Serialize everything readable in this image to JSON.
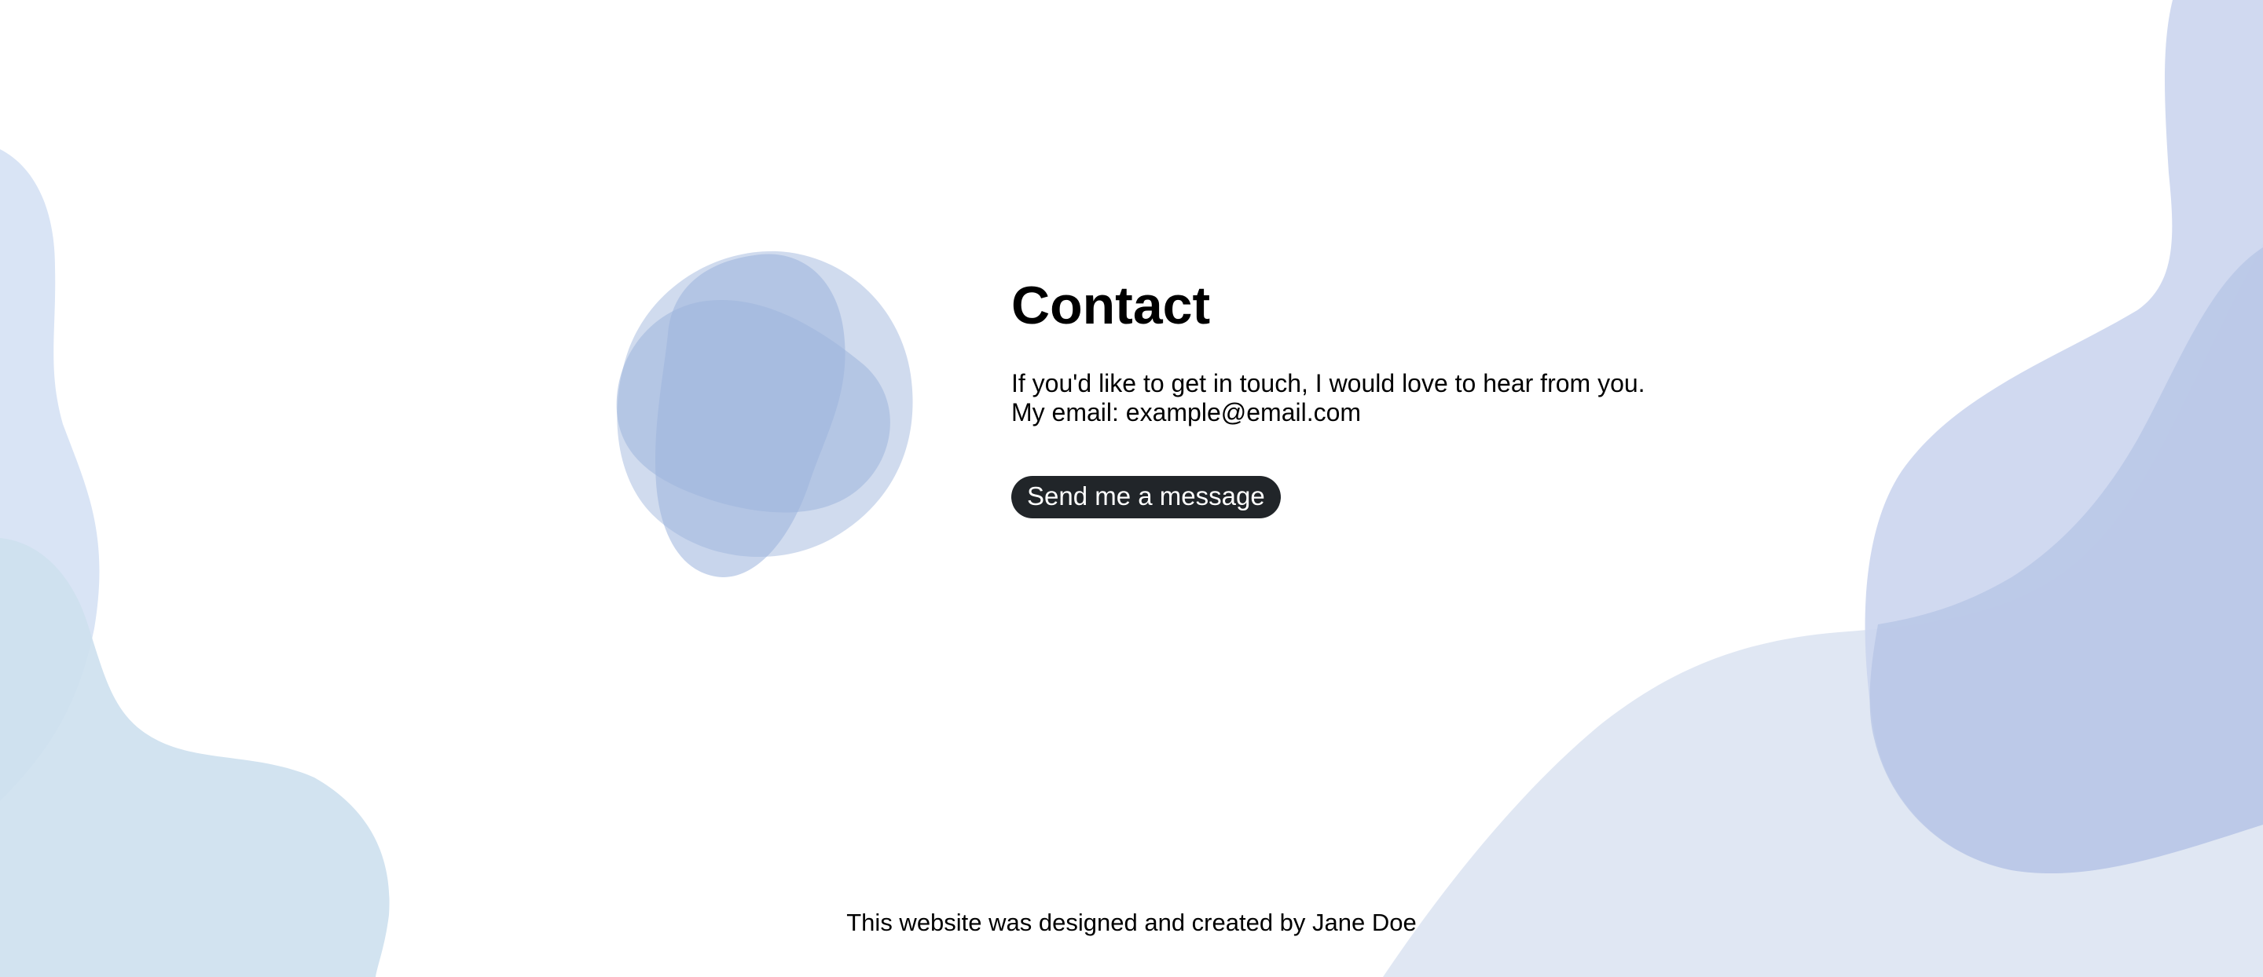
{
  "contact": {
    "title": "Contact",
    "line1": "If you'd like to get in touch, I would love to hear from you.",
    "line2": "My email: example@email.com",
    "button_label": "Send me a message"
  },
  "footer": {
    "text": "This website was designed and created by Jane Doe"
  },
  "colors": {
    "button_bg": "#212529",
    "blob_left_top": "#d9e4f5",
    "blob_left_bottom": "#cfe2ef",
    "blob_right_light": "#e0e7f3",
    "blob_right_mid": "#cfd8ee",
    "blob_right_dark": "#b8c6e6",
    "avatar_blob": "#a9bde0"
  }
}
